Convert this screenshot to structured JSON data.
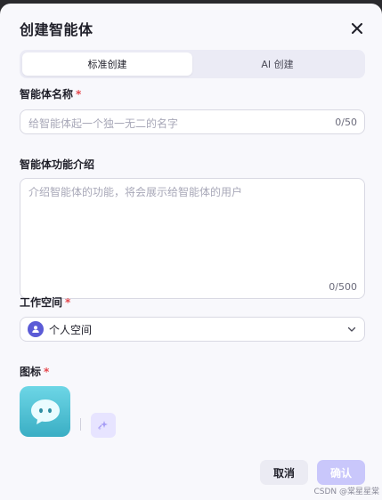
{
  "dialog": {
    "title": "创建智能体",
    "close_icon": "close-icon"
  },
  "tabs": [
    {
      "label": "标准创建",
      "active": true
    },
    {
      "label": "AI 创建",
      "active": false
    }
  ],
  "name_field": {
    "label": "智能体名称",
    "required_mark": "*",
    "placeholder": "给智能体起一个独一无二的名字",
    "counter": "0/50"
  },
  "description_field": {
    "label": "智能体功能介绍",
    "placeholder": "介绍智能体的功能，将会展示给智能体的用户",
    "counter": "0/500"
  },
  "workspace_field": {
    "label": "工作空间",
    "required_mark": "*",
    "value": "个人空间",
    "icon": "person-icon"
  },
  "icon_field": {
    "label": "图标",
    "required_mark": "*",
    "avatar_icon": "chat-bubble-icon",
    "generate_icon": "sparkle-icon"
  },
  "footer": {
    "cancel_label": "取消",
    "confirm_label": "确认"
  },
  "watermark": "CSDN @棠星星棠",
  "colors": {
    "accent": "#5b5bd6",
    "confirm_disabled": "#c9c7fb",
    "required": "#e5484d",
    "avatar_gradient_top": "#6dd6e6",
    "avatar_gradient_bottom": "#3aaec4"
  }
}
